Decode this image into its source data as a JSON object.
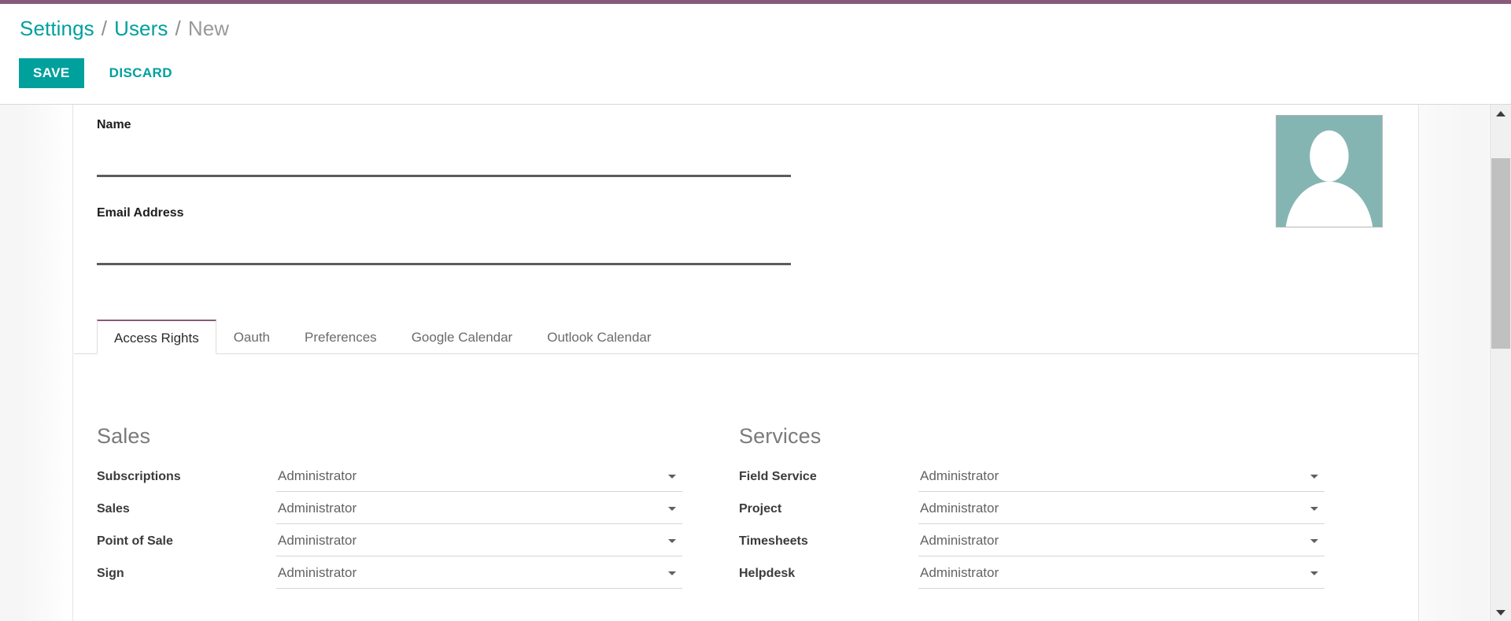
{
  "theme": {
    "accent_purple": "#875a7b",
    "accent_teal": "#00a09d",
    "link_teal": "#00a09d",
    "avatar_bg": "#85b5b2"
  },
  "breadcrumb": {
    "items": [
      {
        "label": "Settings",
        "current": false
      },
      {
        "label": "Users",
        "current": false
      },
      {
        "label": "New",
        "current": true
      }
    ],
    "separator": "/"
  },
  "actions": {
    "save_label": "SAVE",
    "discard_label": "DISCARD"
  },
  "form": {
    "name": {
      "label": "Name",
      "value": "",
      "placeholder": ""
    },
    "email": {
      "label": "Email Address",
      "value": "",
      "placeholder": ""
    },
    "avatar": {
      "name": "user-avatar-placeholder"
    }
  },
  "tabs": [
    {
      "label": "Access Rights",
      "active": true
    },
    {
      "label": "Oauth",
      "active": false
    },
    {
      "label": "Preferences",
      "active": false
    },
    {
      "label": "Google Calendar",
      "active": false
    },
    {
      "label": "Outlook Calendar",
      "active": false
    }
  ],
  "access_rights": {
    "groups": [
      {
        "title": "Sales",
        "rows": [
          {
            "label": "Subscriptions",
            "value": "Administrator"
          },
          {
            "label": "Sales",
            "value": "Administrator"
          },
          {
            "label": "Point of Sale",
            "value": "Administrator"
          },
          {
            "label": "Sign",
            "value": "Administrator"
          }
        ]
      },
      {
        "title": "Services",
        "rows": [
          {
            "label": "Field Service",
            "value": "Administrator"
          },
          {
            "label": "Project",
            "value": "Administrator"
          },
          {
            "label": "Timesheets",
            "value": "Administrator"
          },
          {
            "label": "Helpdesk",
            "value": "Administrator"
          }
        ]
      }
    ]
  },
  "scrollbar": {
    "up_icon": "scroll-up-arrow-icon",
    "down_icon": "scroll-down-arrow-icon"
  }
}
